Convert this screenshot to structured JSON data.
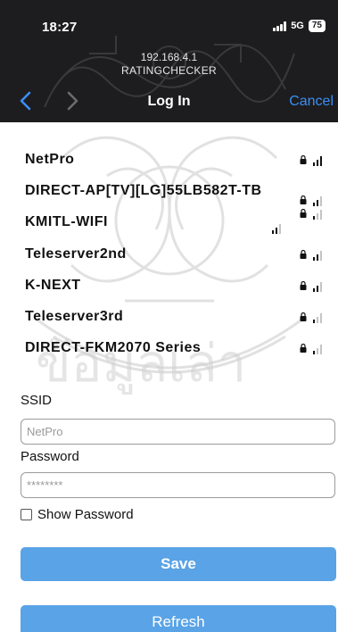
{
  "status_bar": {
    "time": "18:27",
    "network": "5G",
    "battery": "75"
  },
  "header": {
    "ip": "192.168.4.1",
    "host": "RATINGCHECKER"
  },
  "nav": {
    "title": "Log In",
    "cancel_label": "Cancel",
    "accent_color": "#3a8ef6"
  },
  "networks": [
    {
      "ssid": "NetPro",
      "locked": true,
      "signal": 3
    },
    {
      "ssid": "DIRECT-AP[TV][LG]55LB582T-TB",
      "locked": true,
      "signal": 2
    },
    {
      "ssid": "KMITL-WIFI",
      "locked": false,
      "signal": 2
    },
    {
      "ssid": "Teleserver2nd",
      "locked": true,
      "signal": 2
    },
    {
      "ssid": "K-NEXT",
      "locked": true,
      "signal": 2
    },
    {
      "ssid": "Teleserver3rd",
      "locked": true,
      "signal": 1
    },
    {
      "ssid": "DIRECT-FKM2070 Series",
      "locked": true,
      "signal": 1
    }
  ],
  "form": {
    "ssid_label": "SSID",
    "ssid_placeholder": "NetPro",
    "password_label": "Password",
    "password_placeholder": "********",
    "show_password_label": "Show Password"
  },
  "buttons": {
    "save": "Save",
    "refresh": "Refresh",
    "color": "#59a3e6"
  }
}
